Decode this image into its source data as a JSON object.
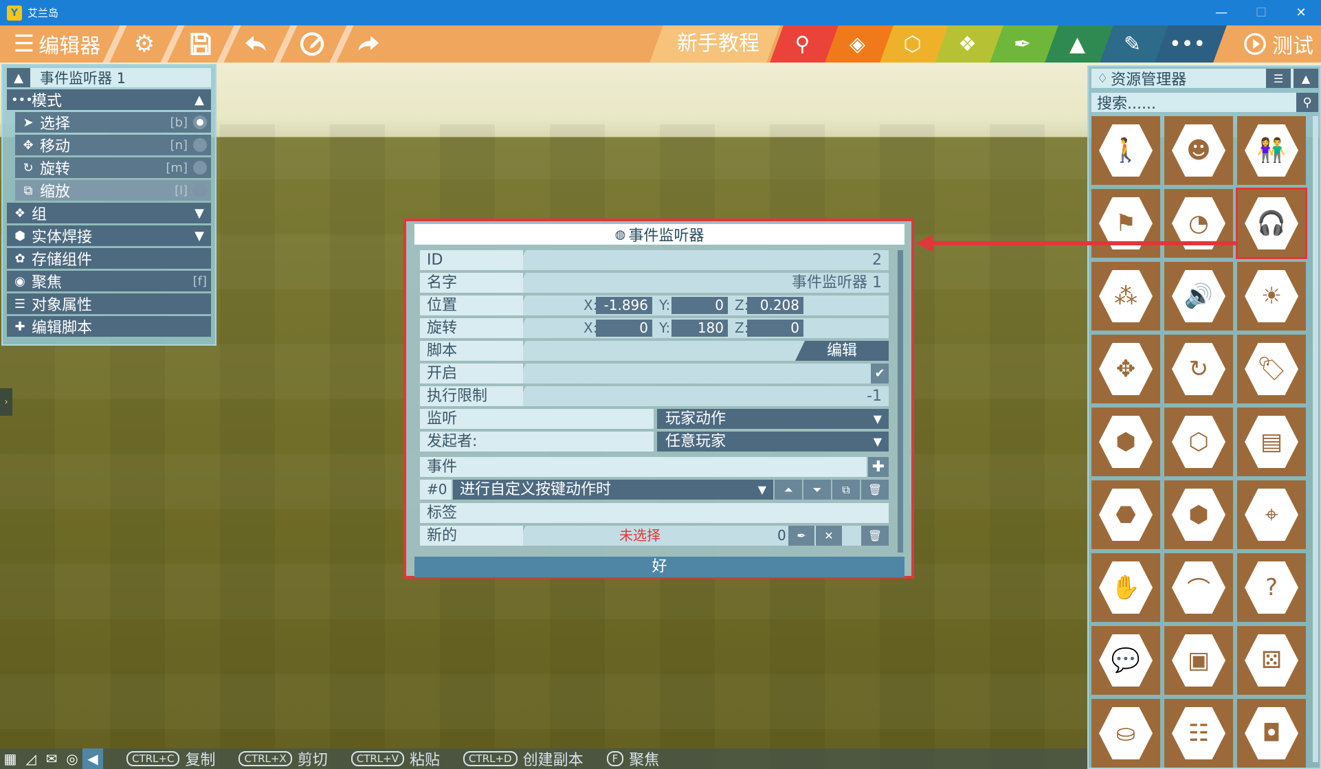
{
  "window": {
    "title": "艾兰岛",
    "logo": "Y",
    "controls": [
      "—",
      "☐",
      "✕"
    ]
  },
  "toolbar": {
    "menu_label": "编辑器",
    "tutorial_label": "新手教程",
    "test_label": "测试",
    "tab_colors": [
      "#e9433a",
      "#f07a1a",
      "#f0b12a",
      "#b6c234",
      "#6fb73a",
      "#2f8a52",
      "#2c6b8a",
      "#2c5f84"
    ],
    "tab_icons": [
      "search-icon",
      "add-gem-icon",
      "add-box-icon",
      "cubes-icon",
      "eyedropper-icon",
      "terrain-icon",
      "paint-icon",
      "more-icon"
    ],
    "more_label": "•••"
  },
  "left_panel": {
    "title": "事件监听器 1",
    "mode_label": "模式",
    "modes": [
      {
        "label": "选择",
        "key": "[b]",
        "active": true
      },
      {
        "label": "移动",
        "key": "[n]",
        "active": false
      },
      {
        "label": "旋转",
        "key": "[m]",
        "active": false
      },
      {
        "label": "缩放",
        "key": "[l]",
        "active": false
      }
    ],
    "group_label": "组",
    "weld_label": "实体焊接",
    "storage_label": "存储组件",
    "focus_label": "聚焦",
    "focus_key": "[f]",
    "props_label": "对象属性",
    "script_label": "编辑脚本"
  },
  "right_panel": {
    "title": "资源管理器",
    "search_placeholder": "搜索......",
    "resources": [
      "person-icon",
      "mask-icon",
      "people-icon",
      "flag-icon",
      "gauge-icon",
      "headphones-icon",
      "particles-icon",
      "speaker-icon",
      "lightbulb-icon",
      "move-area-icon",
      "rotate-area-icon",
      "tag-icon",
      "add-cube-icon",
      "cube-icon",
      "storage-icon",
      "add-hexblock-icon",
      "hexblock-icon",
      "location-pin-icon",
      "hand-icon",
      "path-icon",
      "question-icon",
      "chat-icon",
      "picture-icon",
      "dice-icon",
      "bag-icon",
      "bench-icon",
      "safe-icon"
    ]
  },
  "dialog": {
    "title": "事件监听器",
    "id_label": "ID",
    "id_value": "2",
    "name_label": "名字",
    "name_value": "事件监听器 1",
    "position_label": "位置",
    "position": {
      "x_label": "X:",
      "x": "-1.896",
      "y_label": "Y:",
      "y": "0",
      "z_label": "Z:",
      "z": "0.208"
    },
    "rotation_label": "旋转",
    "rotation": {
      "x_label": "X:",
      "x": "0",
      "y_label": "Y:",
      "y": "180",
      "z_label": "Z:",
      "z": "0"
    },
    "script_label": "脚本",
    "edit_label": "编辑",
    "enabled_label": "开启",
    "limit_label": "执行限制",
    "limit_value": "-1",
    "listen_label": "监听",
    "listen_value": "玩家动作",
    "initiator_label": "发起者:",
    "initiator_value": "任意玩家",
    "events_label": "事件",
    "event_num": "#0",
    "event_value": "进行自定义按键动作时",
    "tags_label": "标签",
    "new_label": "新的",
    "unselected": "未选择",
    "new_count": "0",
    "ok_label": "好"
  },
  "bottom_bar": {
    "shortcuts": [
      {
        "key": "CTRL+C",
        "label": "复制"
      },
      {
        "key": "CTRL+X",
        "label": "剪切"
      },
      {
        "key": "CTRL+V",
        "label": "粘贴"
      },
      {
        "key": "CTRL+D",
        "label": "创建副本"
      },
      {
        "key": "F",
        "label": "聚焦"
      }
    ]
  }
}
